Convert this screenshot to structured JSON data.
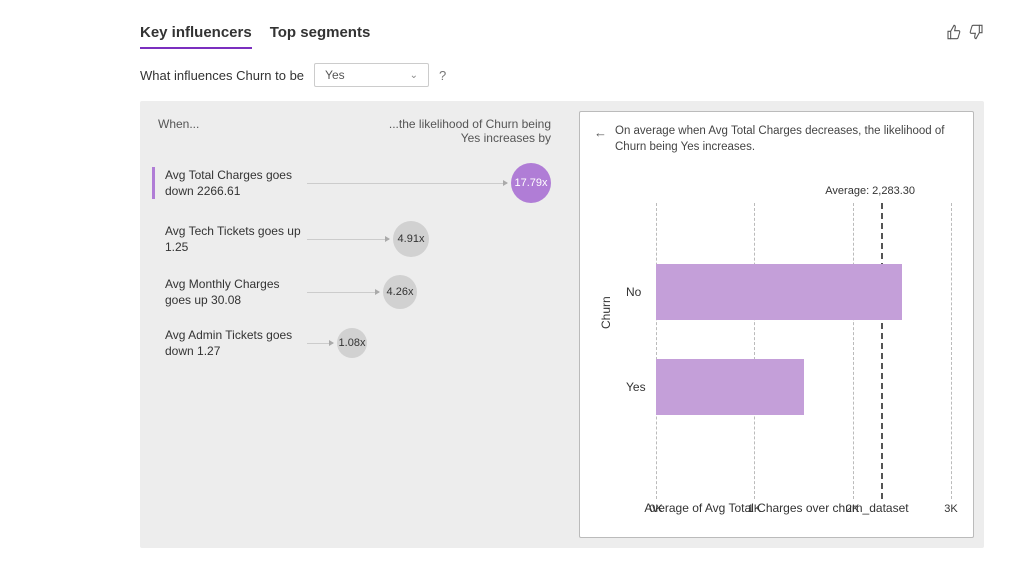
{
  "tabs": {
    "key_influencers": "Key influencers",
    "top_segments": "Top segments"
  },
  "question": {
    "prefix": "What influences Churn to be",
    "selected_value": "Yes",
    "help_icon": "?"
  },
  "col_headers": {
    "when": "When...",
    "increase": "...the likelihood of Churn being Yes increases by"
  },
  "influencers": [
    {
      "label": "Avg Total Charges goes down 2266.61",
      "factor": "17.79x",
      "size": 40,
      "offset": 228,
      "selected": true
    },
    {
      "label": "Avg Tech Tickets goes up 1.25",
      "factor": "4.91x",
      "size": 36,
      "offset": 82,
      "selected": false
    },
    {
      "label": "Avg Monthly Charges goes up 30.08",
      "factor": "4.26x",
      "size": 34,
      "offset": 72,
      "selected": false
    },
    {
      "label": "Avg Admin Tickets goes down 1.27",
      "factor": "1.08x",
      "size": 30,
      "offset": 26,
      "selected": false
    }
  ],
  "right": {
    "insight": "On average when Avg Total Charges decreases, the likelihood of Churn being Yes increases.",
    "avg_label": "Average: 2,283.30",
    "y_axis_title": "Churn",
    "x_axis_title": "Average of Avg Total Charges over churn_dataset"
  },
  "chart_data": {
    "type": "bar",
    "orientation": "horizontal",
    "categories": [
      "No",
      "Yes"
    ],
    "values": [
      2500,
      1500
    ],
    "average_line": 2283.3,
    "xlabel": "Average of Avg Total Charges over churn_dataset",
    "ylabel": "Churn",
    "xlim": [
      0,
      3000
    ],
    "x_ticks": [
      0,
      1000,
      2000,
      3000
    ],
    "x_tick_labels": [
      "0K",
      "1K",
      "2K",
      "3K"
    ]
  }
}
